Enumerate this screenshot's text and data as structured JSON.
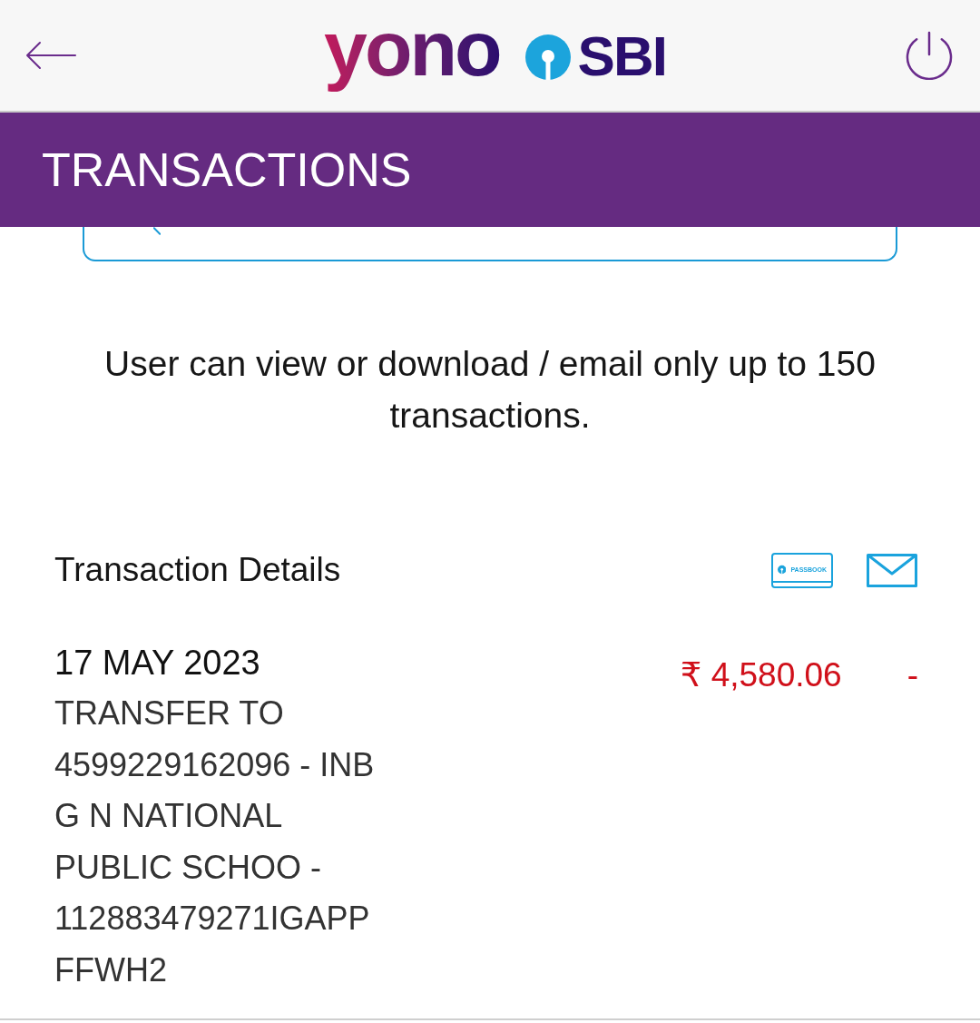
{
  "header": {
    "logo": {
      "brand": "yono",
      "bank": "SBI"
    }
  },
  "title_bar": {
    "title": "TRANSACTIONS"
  },
  "notice": "User can view or download / email only up to 150 transactions.",
  "details": {
    "heading": "Transaction Details",
    "passbook_label": "PASSBOOK"
  },
  "transactions": [
    {
      "kind": "debit",
      "date": "17 MAY 2023",
      "description_lines": [
        "TRANSFER TO",
        "4599229162096 - INB",
        "G N NATIONAL",
        "PUBLIC SCHOO -",
        "112883479271IGAPP",
        "FFWH2"
      ],
      "amount": "₹ 4,580.06",
      "marker": "-"
    }
  ]
}
